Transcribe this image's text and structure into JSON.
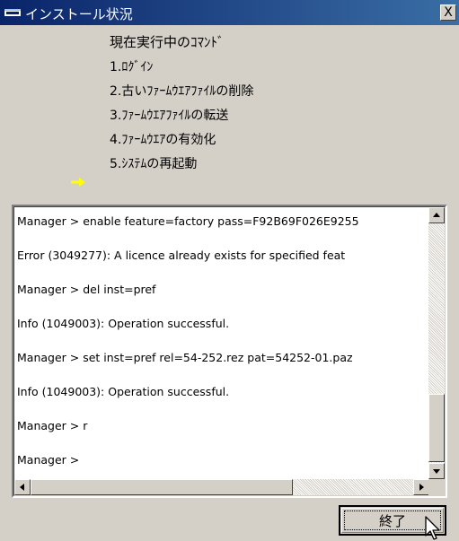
{
  "window": {
    "title": "インストール状況",
    "close_label": "X"
  },
  "commands": {
    "heading": "現在実行中のｺﾏﾝﾄﾞ",
    "steps": [
      "1.ﾛｸﾞｲﾝ",
      "2.古いﾌｧｰﾑｳｴｱﾌｧｲﾙの削除",
      "3.ﾌｧｰﾑｳｴｱﾌｧｲﾙの転送",
      "4.ﾌｧｰﾑｳｴｱの有効化",
      "5.ｼｽﾃﾑの再起動"
    ],
    "current_step_index": 4,
    "arrow_color": "#ffff00"
  },
  "console": {
    "lines": [
      "Manager > enable feature=factory pass=F92B69F026E9255",
      "Error (3049277): A licence already exists for specified feat",
      "Manager > del inst=pref",
      "Info (1049003): Operation successful.",
      "Manager > set inst=pref rel=54-252.rez pat=54252-01.paz",
      "Info (1049003): Operation successful.",
      "Manager > r",
      "Manager >"
    ]
  },
  "footer": {
    "end_label": "終了"
  }
}
